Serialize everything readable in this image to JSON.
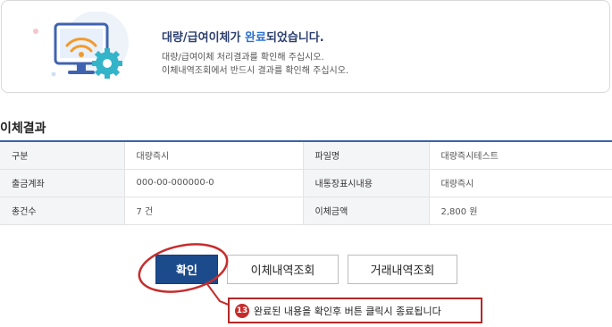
{
  "banner": {
    "title_part1": "대량/급여이체",
    "title_part2": "가 ",
    "title_accent": "완료",
    "title_part3": "되었습니다.",
    "line1": "대량/급여이체 처리결과를 확인해 주십시오.",
    "line2": "이체내역조회에서 반드시 결과를 확인해 주십시오."
  },
  "result": {
    "title": "이체결과",
    "rows": [
      [
        "구분",
        "대량즉시",
        "파일명",
        "대량즉시테스트"
      ],
      [
        "출금계좌",
        "000-00-000000-0",
        "내통장표시내용",
        "대량즉시"
      ],
      [
        "총건수",
        "7 건",
        "이체금액",
        "2,800 원"
      ]
    ]
  },
  "buttons": {
    "confirm": "확인",
    "transfer_history": "이체내역조회",
    "transaction_history": "거래내역조회"
  },
  "callout": {
    "number": "13",
    "text": "완료된 내용을 확인후 버튼 클릭시 종료됩니다"
  },
  "colors": {
    "primary": "#1c4b8c",
    "accent_blue": "#2a6fd0",
    "annotation_red": "#c62c2c"
  }
}
